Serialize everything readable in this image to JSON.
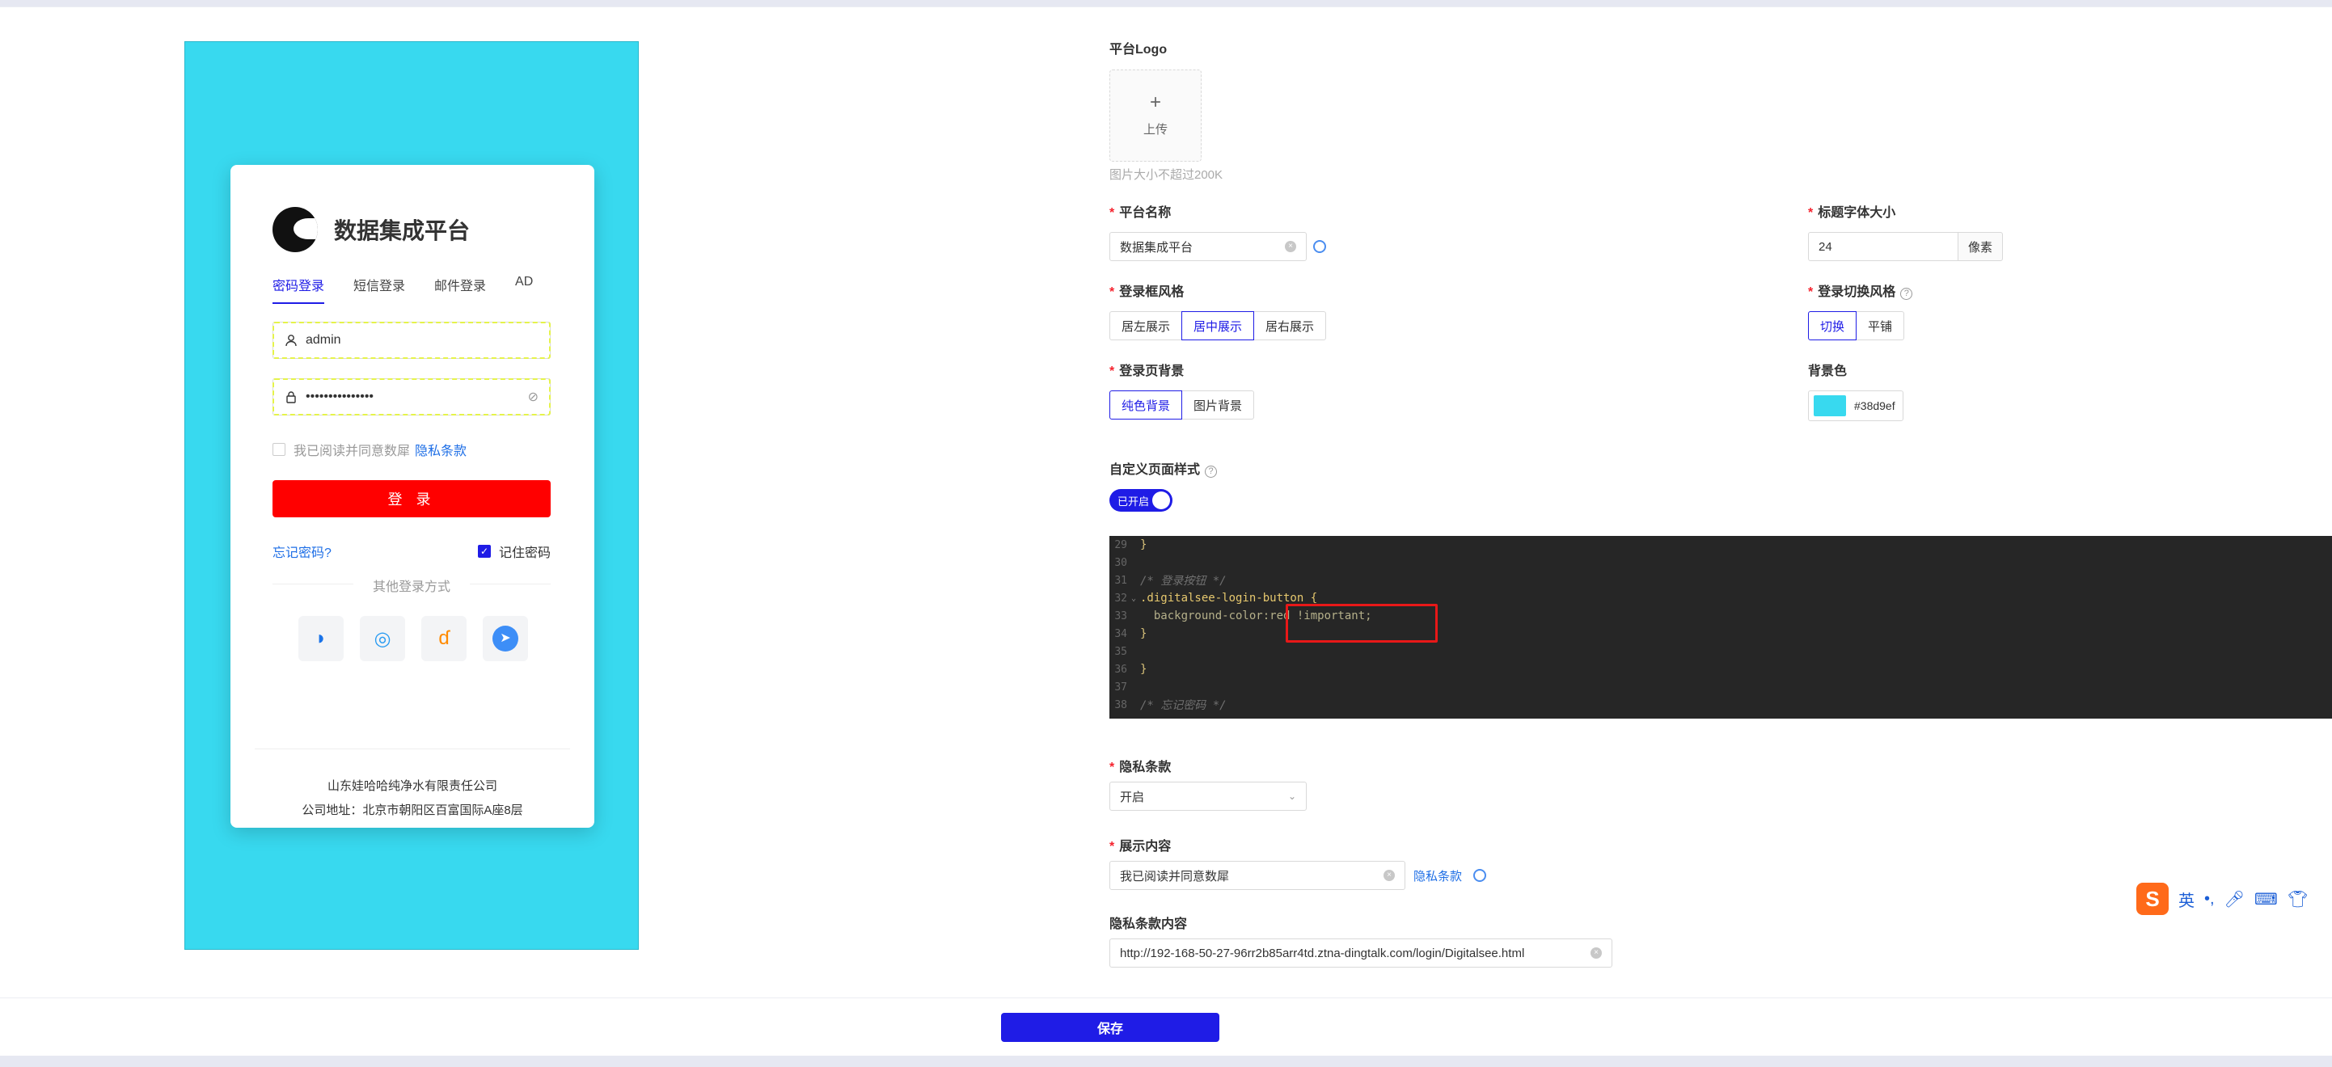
{
  "preview": {
    "platform_title": "数据集成平台",
    "tabs": [
      "密码登录",
      "短信登录",
      "邮件登录",
      "AD"
    ],
    "username": "admin",
    "password_mask": "•••••••••••••••",
    "agree_text": "我已阅读并同意数犀",
    "agree_link": "隐私条款",
    "login_button": "登 录",
    "forgot_password": "忘记密码?",
    "remember_password": "记住密码",
    "other_login": "其他登录方式",
    "social_icons": [
      "feishu-icon",
      "wechat-work-icon",
      "dingtalk-icon",
      "lark-icon"
    ],
    "company_name": "山东娃哈哈纯净水有限责任公司",
    "company_address": "公司地址：北京市朝阳区百富国际A座8层"
  },
  "settings": {
    "logo_label": "平台Logo",
    "upload_plus": "+",
    "upload_text": "上传",
    "upload_hint": "图片大小不超过200K",
    "platform_name_label": "平台名称",
    "platform_name_value": "数据集成平台",
    "title_font_size_label": "标题字体大小",
    "title_font_size_value": "24",
    "title_font_size_unit": "像素",
    "login_box_style_label": "登录框风格",
    "login_box_style_options": [
      "居左展示",
      "居中展示",
      "居右展示"
    ],
    "login_box_style_selected": "居中展示",
    "login_switch_style_label": "登录切换风格",
    "login_switch_style_options": [
      "切换",
      "平铺"
    ],
    "login_switch_style_selected": "切换",
    "login_bg_label": "登录页背景",
    "login_bg_options": [
      "纯色背景",
      "图片背景"
    ],
    "login_bg_selected": "纯色背景",
    "bg_color_label": "背景色",
    "bg_color_value": "#38d9ef",
    "custom_style_label": "自定义页面样式",
    "custom_style_toggle": "已开启",
    "code_lines": [
      {
        "n": "29",
        "text": "}",
        "kind": "plain"
      },
      {
        "n": "30",
        "text": "",
        "kind": "plain"
      },
      {
        "n": "31",
        "text": "/* 登录按钮 */",
        "kind": "comment"
      },
      {
        "n": "32",
        "text": ".digitalsee-login-button {",
        "kind": "selector"
      },
      {
        "n": "33",
        "text": "  background-color:red !important;",
        "kind": "prop"
      },
      {
        "n": "34",
        "text": "}",
        "kind": "plain"
      },
      {
        "n": "35",
        "text": "",
        "kind": "plain"
      },
      {
        "n": "36",
        "text": "}",
        "kind": "plain"
      },
      {
        "n": "37",
        "text": "",
        "kind": "plain"
      },
      {
        "n": "38",
        "text": "/* 忘记密码 */",
        "kind": "comment"
      }
    ],
    "privacy_label": "隐私条款",
    "privacy_value": "开启",
    "display_content_label": "展示内容",
    "display_content_value": "我已阅读并同意数犀",
    "display_content_link": "隐私条款",
    "privacy_content_label": "隐私条款内容",
    "privacy_content_value": "http://192-168-50-27-96rr2b85arr4td.ztna-dingtalk.com/login/Digitalsee.html"
  },
  "footer": {
    "save_button": "保存"
  },
  "ime": {
    "logo": "S",
    "mode": "英"
  },
  "colors": {
    "accent": "#1f1ce6",
    "preview_bg": "#38d9ef",
    "login_button": "#ff0000",
    "highlight_box": "#e81818"
  }
}
